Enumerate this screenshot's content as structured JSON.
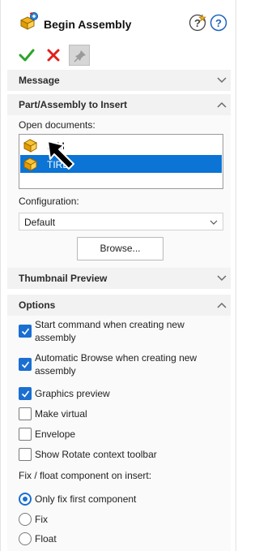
{
  "header": {
    "title": "Begin Assembly",
    "icon": "begin-assembly-icon",
    "help_icons": [
      "whats-new-help-icon",
      "help-icon"
    ]
  },
  "toolbar": {
    "ok_icon": "check-icon",
    "cancel_icon": "close-icon",
    "pin_icon": "pin-icon"
  },
  "sections": {
    "message": {
      "label": "Message",
      "expanded": false
    },
    "part_insert": {
      "label": "Part/Assembly to Insert",
      "expanded": true,
      "open_documents_label": "Open documents:",
      "documents": [
        {
          "name": "RIM",
          "selected": false
        },
        {
          "name": "TIRE",
          "selected": true
        }
      ],
      "configuration_label": "Configuration:",
      "configuration_value": "Default",
      "browse_label": "Browse..."
    },
    "thumbnail": {
      "label": "Thumbnail Preview",
      "expanded": false
    },
    "options": {
      "label": "Options",
      "expanded": true,
      "checkboxes": [
        {
          "label_line1": "Start command when creating new",
          "label_line2": "assembly",
          "checked": true
        },
        {
          "label_line1": "Automatic Browse when creating new",
          "label_line2": "assembly",
          "checked": true
        },
        {
          "label_line1": "Graphics preview",
          "label_line2": "",
          "checked": true
        },
        {
          "label_line1": "Make virtual",
          "label_line2": "",
          "checked": false
        },
        {
          "label_line1": "Envelope",
          "label_line2": "",
          "checked": false
        },
        {
          "label_line1": "Show Rotate context toolbar",
          "label_line2": "",
          "checked": false
        }
      ],
      "fix_float_label": "Fix / float component on insert:",
      "radios": [
        {
          "label": "Only fix first component",
          "selected": true
        },
        {
          "label": "Fix",
          "selected": false
        },
        {
          "label": "Float",
          "selected": false
        }
      ]
    }
  },
  "colors": {
    "accent": "#1b6fd1",
    "selection": "#0b74d4",
    "ok_green": "#2aa52a",
    "cancel_red": "#e0201c",
    "section_header_bg": "#f2f2f2"
  }
}
